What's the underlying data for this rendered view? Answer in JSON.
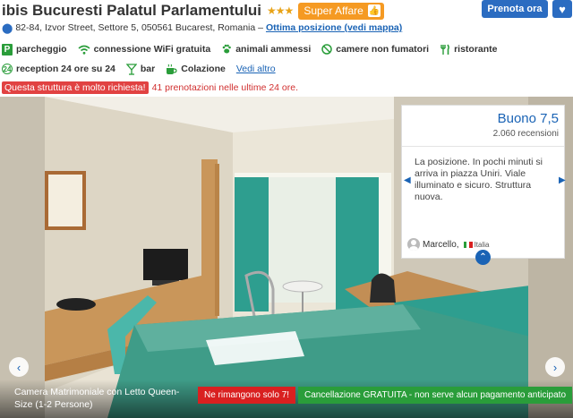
{
  "hotel": {
    "name": "ibis Bucuresti Palatul Parlamentului",
    "stars": "★★★",
    "badge_label": "Super Affare",
    "address": "82-84, Izvor Street, Settore 5, 050561 Bucarest, Romania –",
    "address_link": "Ottima posizione (vedi mappa)"
  },
  "actions": {
    "book_label": "Prenota ora",
    "favorite_icon": "heart-icon"
  },
  "amenities_row1": [
    {
      "icon": "P",
      "label": "parcheggio"
    },
    {
      "icon": "wifi-icon",
      "label": "connessione WiFi gratuita"
    },
    {
      "icon": "paw-icon",
      "label": "animali ammessi"
    },
    {
      "icon": "no-smoking-icon",
      "label": "camere non fumatori"
    },
    {
      "icon": "cutlery-icon",
      "label": "ristorante"
    }
  ],
  "amenities_row2": [
    {
      "icon": "24",
      "label": "reception 24 ore su 24"
    },
    {
      "icon": "cocktail-icon",
      "label": "bar"
    },
    {
      "icon": "coffee-icon",
      "label": "Colazione"
    }
  ],
  "see_more": "Vedi altro",
  "demand": {
    "badge": "Questa struttura è molto richiesta!",
    "text": "41 prenotazioni nelle ultime 24 ore."
  },
  "review": {
    "rating": "Buono 7,5",
    "count": "2.060 recensioni",
    "text": "La posizione. In pochi minuti si arriva in piazza Uniri. Viale illuminato e sicuro. Struttura nuova.",
    "author": "Marcello,",
    "country": "Italia"
  },
  "photo": {
    "caption": "Camera Matrimoniale con Letto Queen-Size (1-2 Persone)",
    "scarcity": "Ne rimangono solo 7!",
    "cancellation": "Cancellazione GRATUITA - non serve alcun pagamento anticipato"
  }
}
